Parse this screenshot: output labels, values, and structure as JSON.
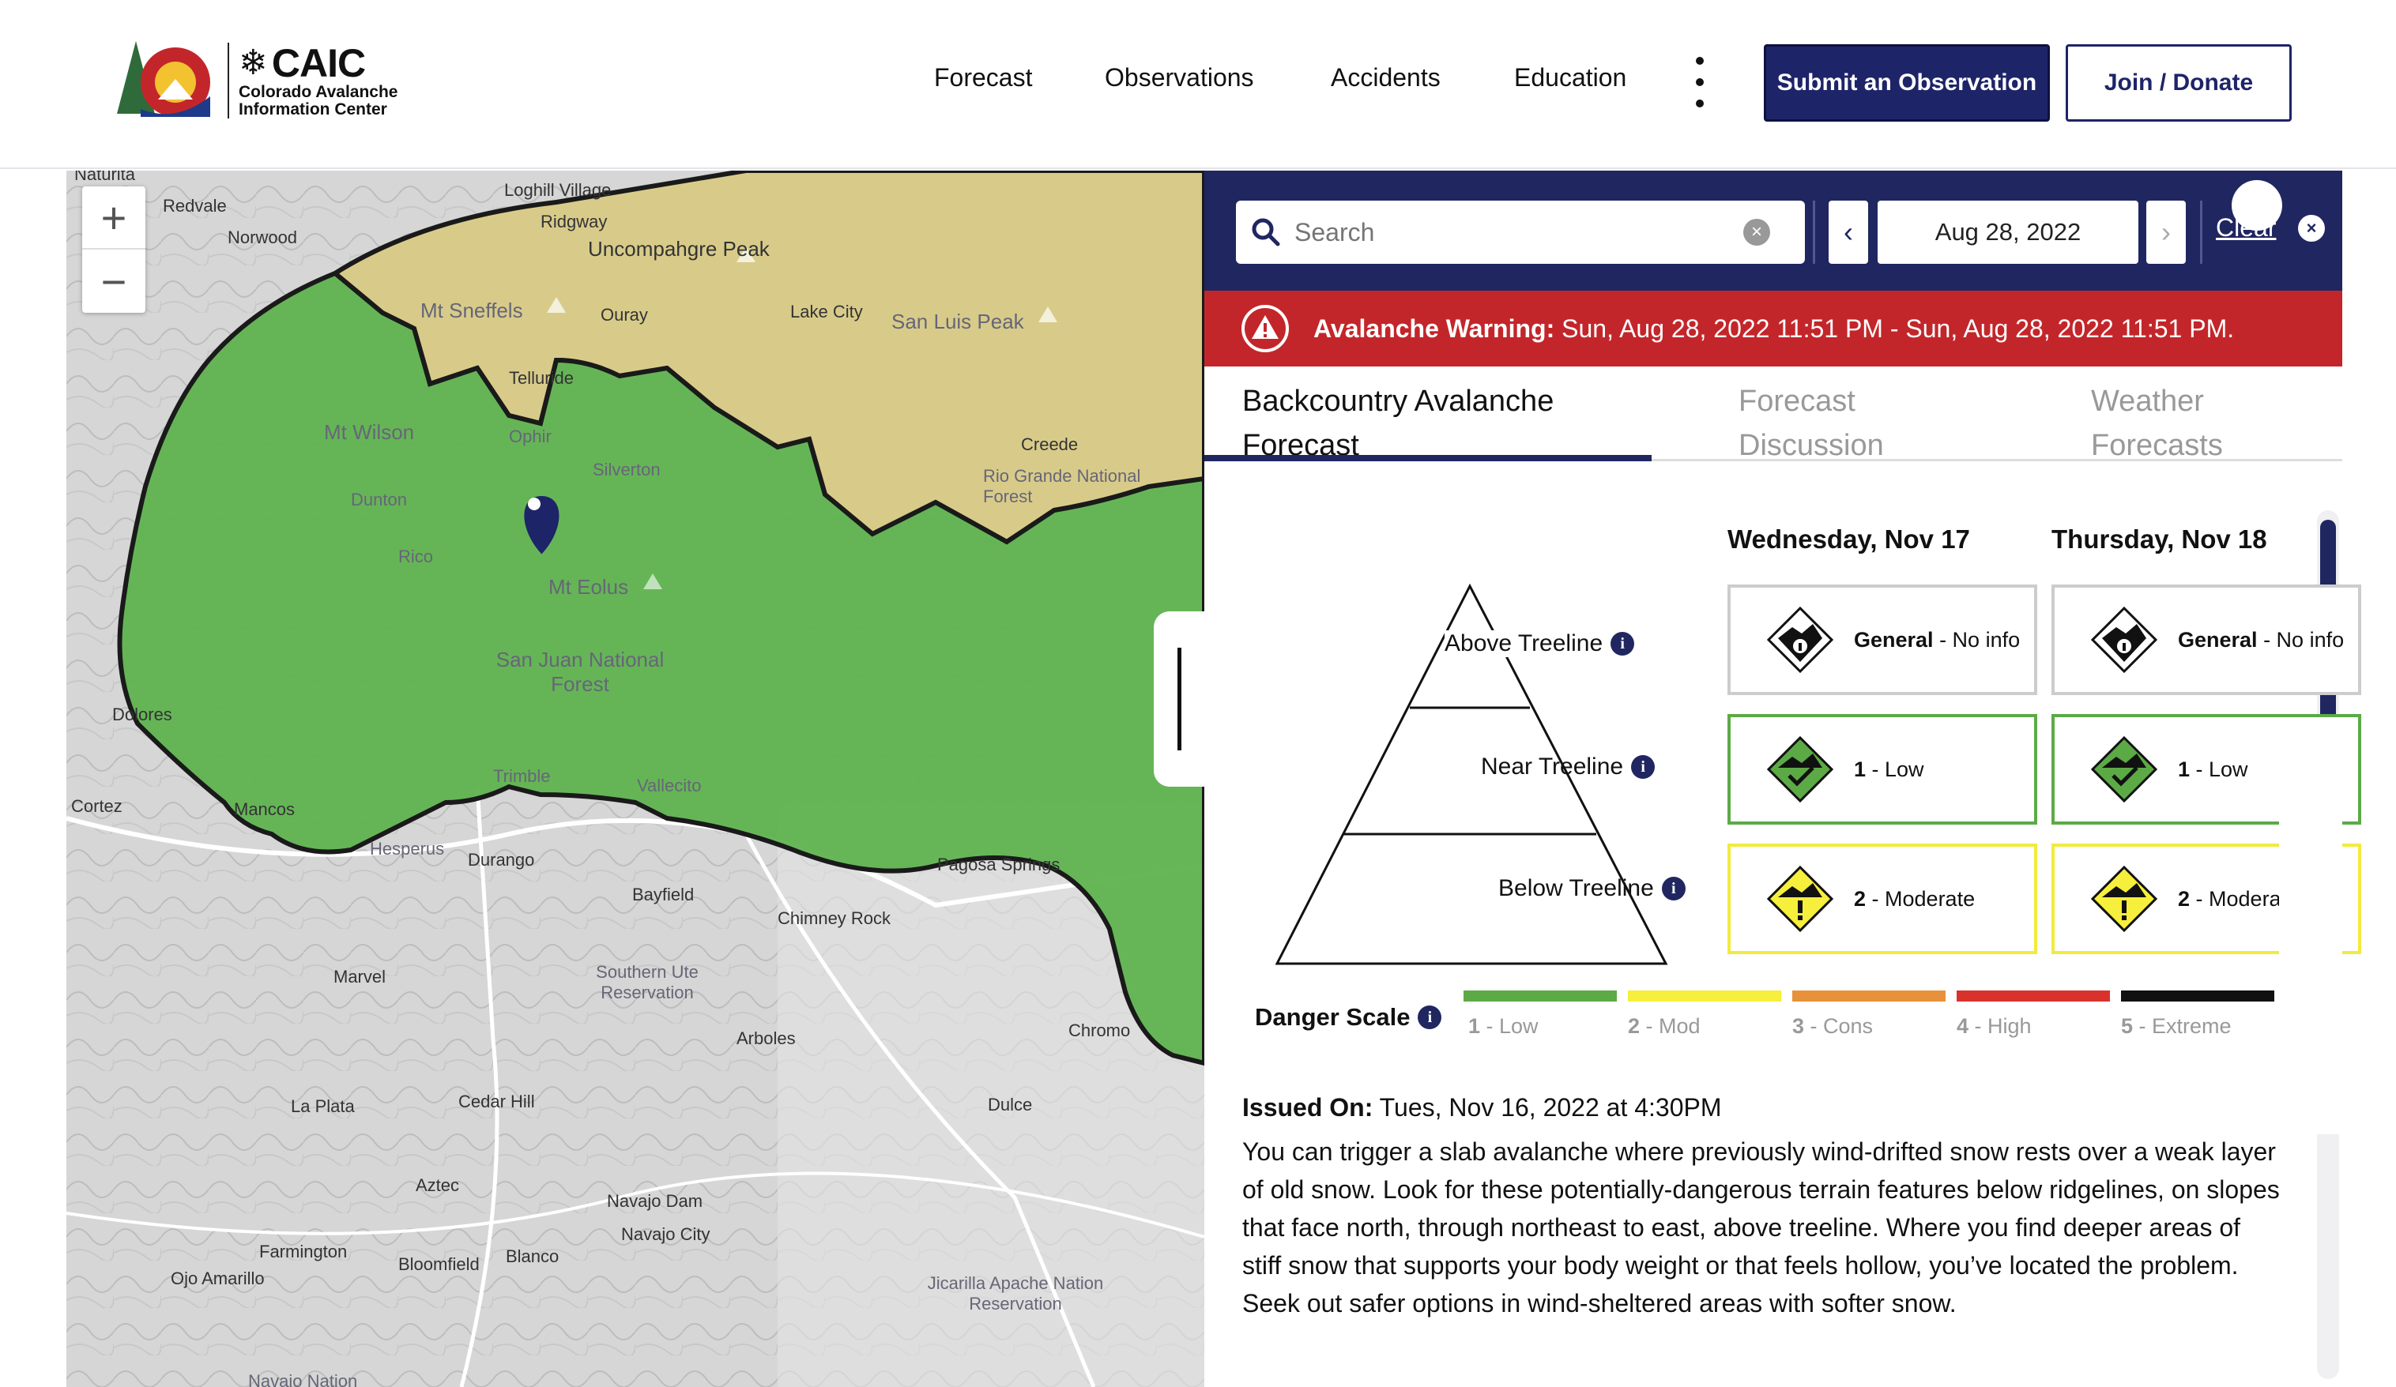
{
  "header": {
    "logo_abbr": "CAIC",
    "logo_line1": "Colorado Avalanche",
    "logo_line2": "Information Center",
    "nav": [
      "Forecast",
      "Observations",
      "Accidents",
      "Education"
    ],
    "submit_label": "Submit an Observation",
    "join_label": "Join / Donate"
  },
  "map": {
    "zoom_in": "+",
    "zoom_out": "−",
    "labels": [
      "Naturita",
      "Redvale",
      "Norwood",
      "Loghill Village",
      "Ridgway",
      "Uncompahgre Peak",
      "Mt Sneffels",
      "Ouray",
      "Lake City",
      "San Luis Peak",
      "Telluride",
      "Mt Wilson",
      "Ophir",
      "Silverton",
      "Creede",
      "Rio Grande National Forest",
      "Dunton",
      "Rico",
      "Mt Eolus",
      "San Juan National Forest",
      "Dolores",
      "Cortez",
      "Mancos",
      "Hesperus",
      "Durango",
      "Trimble",
      "Vallecito",
      "Bayfield",
      "Pagosa Springs",
      "Chimney Rock",
      "Marvel",
      "Southern Ute Reservation",
      "Arboles",
      "Chromo",
      "La Plata",
      "Cedar Hill",
      "Dulce",
      "Aztec",
      "Navajo Dam",
      "Navajo City",
      "Farmington",
      "Bloomfield",
      "Blanco",
      "Ojo Amarillo",
      "Jicarilla Apache Nation Reservation",
      "Navajo Nation"
    ],
    "colors": {
      "green_zone": "#5fb350",
      "yellow_zone": "#d8cb8a",
      "boundary": "#1a1a1a",
      "pin": "#1e2468"
    }
  },
  "panel": {
    "search_placeholder": "Search",
    "date": "Aug 28, 2022",
    "clear_label": "Clear",
    "warning_title": "Avalanche Warning:",
    "warning_text": " Sun, Aug 28, 2022 11:51 PM - Sun, Aug 28, 2022 11:51 PM.",
    "tabs": [
      {
        "line1": "Backcountry Avalanche",
        "line2": "Forecast"
      },
      {
        "line1": "Forecast",
        "line2": "Discussion"
      },
      {
        "line1": "Weather",
        "line2": "Forecasts"
      }
    ],
    "days": [
      "Wednesday, Nov 17",
      "Thursday, Nov 18"
    ],
    "elevations": [
      "Above Treeline",
      "Near Treeline",
      "Below Treeline"
    ],
    "ratings": {
      "day1": [
        {
          "level": "General",
          "desc": " - No info"
        },
        {
          "level": "1",
          "desc": " - Low"
        },
        {
          "level": "2",
          "desc": " - Moderate"
        }
      ],
      "day2": [
        {
          "level": "General",
          "desc": " - No info"
        },
        {
          "level": "1",
          "desc": " - Low"
        },
        {
          "level": "2",
          "desc": " - Moderate"
        }
      ]
    },
    "danger_scale_label": "Danger Scale",
    "danger_scale": [
      {
        "num": "1",
        "name": " - Low",
        "color": "#5caa46"
      },
      {
        "num": "2",
        "name": " - Mod",
        "color": "#f6ef3b"
      },
      {
        "num": "3",
        "name": " - Cons",
        "color": "#e8913b"
      },
      {
        "num": "4",
        "name": " - High",
        "color": "#d9312c"
      },
      {
        "num": "5",
        "name": " - Extreme",
        "color": "#111111"
      }
    ],
    "issued_label": "Issued On:",
    "issued_value": " Tues, Nov 16, 2022 at 4:30PM",
    "summary": "You can trigger a slab avalanche where previously wind-drifted snow rests over a weak layer of old snow. Look for these potentially-dangerous terrain features below ridgelines, on slopes that face north, through northeast to east, above treeline. Where you find deeper areas of stiff snow that supports your body weight or that feels hollow, you’ve located the problem. Seek out safer options in wind-sheltered areas with softer snow."
  }
}
